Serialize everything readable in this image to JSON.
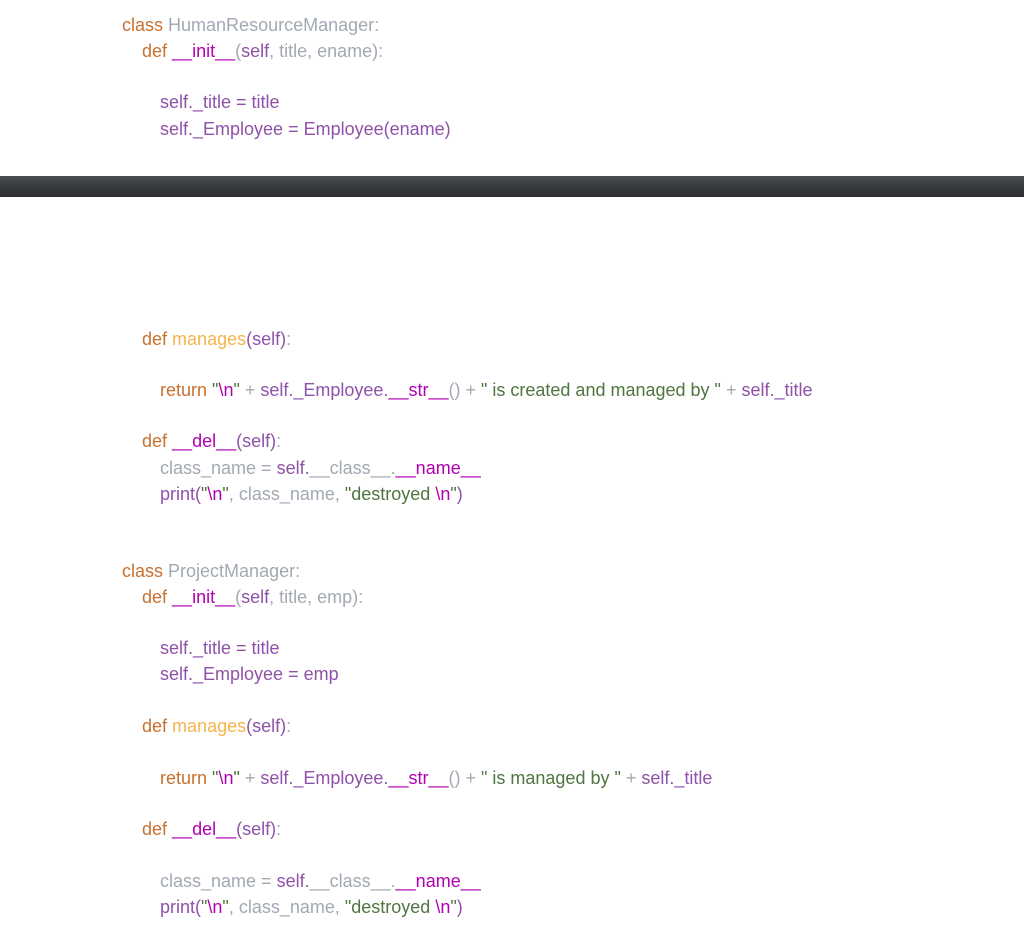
{
  "block1": {
    "l1": {
      "kw": "class",
      "name": "HumanResourceManager:"
    },
    "l2": {
      "kw": "def",
      "dunder": "__init__",
      "rest_a": "(",
      "self": "self",
      "rest_b": ", title, ename):"
    },
    "l3": "self._title = title",
    "l4": "self._Employee = Employee(ename)"
  },
  "block2": {
    "l1": {
      "kw": "def",
      "fn": "manages",
      "self": "(self)",
      "rest": ":"
    },
    "l2": {
      "kw": "return",
      "s1": "\"",
      "esc1": "\\n",
      "s2": "\"",
      "plus1": " + ",
      "self": "self._Employee.",
      "dunder": "__str__",
      "paren": "()",
      "plus2": " + ",
      "str": "\" is created and managed by \"",
      "plus3": " + ",
      "selft": "self._title"
    },
    "l3": {
      "kw": "def",
      "dunder": "__del__",
      "self": "(self)",
      "rest": ":"
    },
    "l4": {
      "a": "class_name = ",
      "self": "self.",
      "cls": "__class__",
      "dot": ".",
      "dunder": "__name__"
    },
    "l5": {
      "pr": "print(",
      "s1": "\"",
      "esc": "\\n",
      "s2": "\"",
      "mid": ", class_name, ",
      "s3": "\"destroyed ",
      "esc2": "\\n",
      "s4": "\"",
      "close": ")"
    }
  },
  "block3": {
    "l1": {
      "kw": "class",
      "name": "ProjectManager:"
    },
    "l2": {
      "kw": "def",
      "dunder": "__init__",
      "rest_a": "(",
      "self": "self",
      "rest_b": ", title, emp):"
    },
    "l3": "self._title = title",
    "l4": "self._Employee = emp",
    "l5": {
      "kw": "def",
      "fn": "manages",
      "self": "(self)",
      "rest": ":"
    },
    "l6": {
      "kw": "return",
      "s1": "\"",
      "esc1": "\\n",
      "s2": "\"",
      "plus1": " + ",
      "self": "self._Employee.",
      "dunder": "__str__",
      "paren": "()",
      "plus2": " + ",
      "str": "\" is managed by \"",
      "plus3": " + ",
      "selft": "self._title"
    },
    "l7": {
      "kw": "def",
      "dunder": "__del__",
      "self": "(self)",
      "rest": ":"
    },
    "l8": {
      "a": "class_name = ",
      "self": "self.",
      "cls": "__class__",
      "dot": ".",
      "dunder": "__name__"
    },
    "l9": {
      "pr": "print(",
      "s1": "\"",
      "esc": "\\n",
      "s2": "\"",
      "mid": ", class_name, ",
      "s3": "\"destroyed ",
      "esc2": "\\n",
      "s4": "\"",
      "close": ")"
    }
  },
  "colors": {
    "keyword": "#c8702e",
    "dunder": "#b100b1",
    "self": "#8f52a8",
    "function": "#f5b44c",
    "string": "#4f7640",
    "plain": "#a2a9b3",
    "divider": "#3a3d41"
  }
}
